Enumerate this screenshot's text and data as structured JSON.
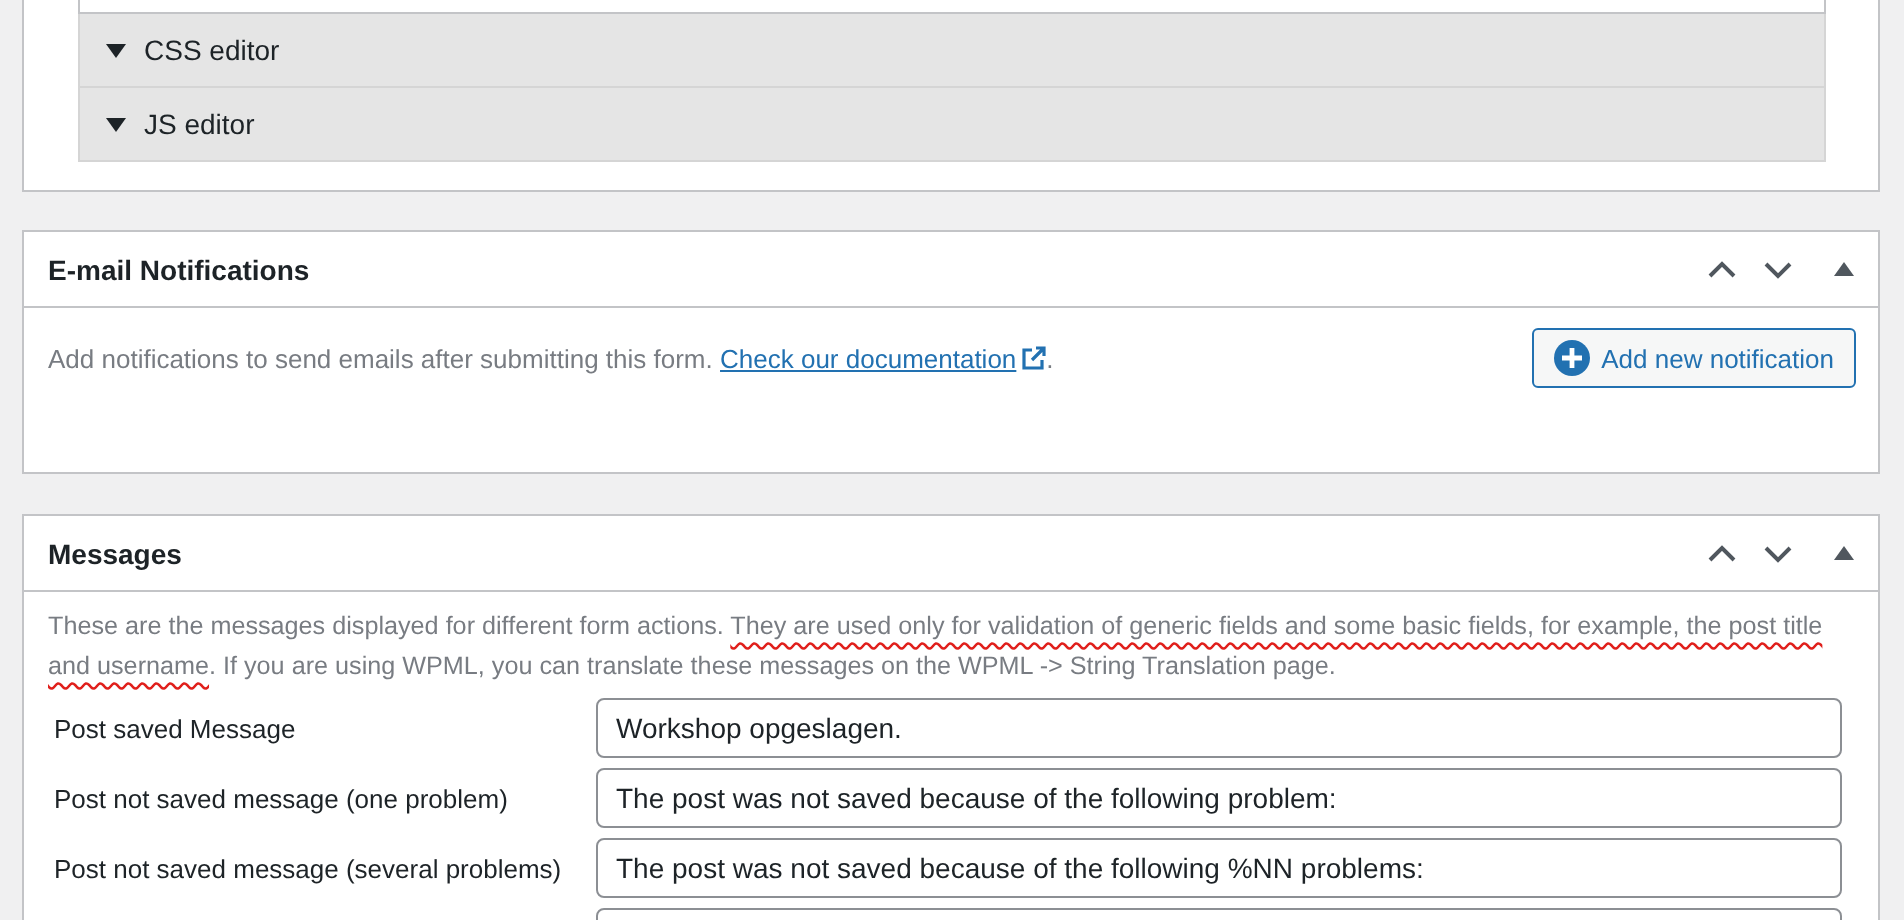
{
  "editor_panel": {
    "sections": [
      {
        "label": "CSS editor",
        "expanded": false
      },
      {
        "label": "JS editor",
        "expanded": false
      }
    ]
  },
  "notifications_panel": {
    "title": "E-mail Notifications",
    "description": "Add notifications to send emails after submitting this form.",
    "link": "Check our documentation",
    "after_link": ".",
    "button": "Add new notification"
  },
  "messages_panel": {
    "title": "Messages",
    "description": [
      {
        "text": "These are the messages displayed for different form actions. ",
        "underlined": false
      },
      {
        "text": "They are used only for validation of generic fields and some basic fields, for example, the post title and username",
        "underlined": true
      },
      {
        "text": ". If you are using WPML, you can translate these messages on the WPML -> String Translation page.",
        "underlined": false
      }
    ],
    "rows": [
      {
        "label": "Post saved Message",
        "value": "Workshop opgeslagen."
      },
      {
        "label": "Post not saved message (one problem)",
        "value": "The post was not saved because of the following problem:"
      },
      {
        "label": "Post not saved message (several problems)",
        "value": "The post was not saved because of the following %NN problems:"
      },
      {}
    ]
  }
}
